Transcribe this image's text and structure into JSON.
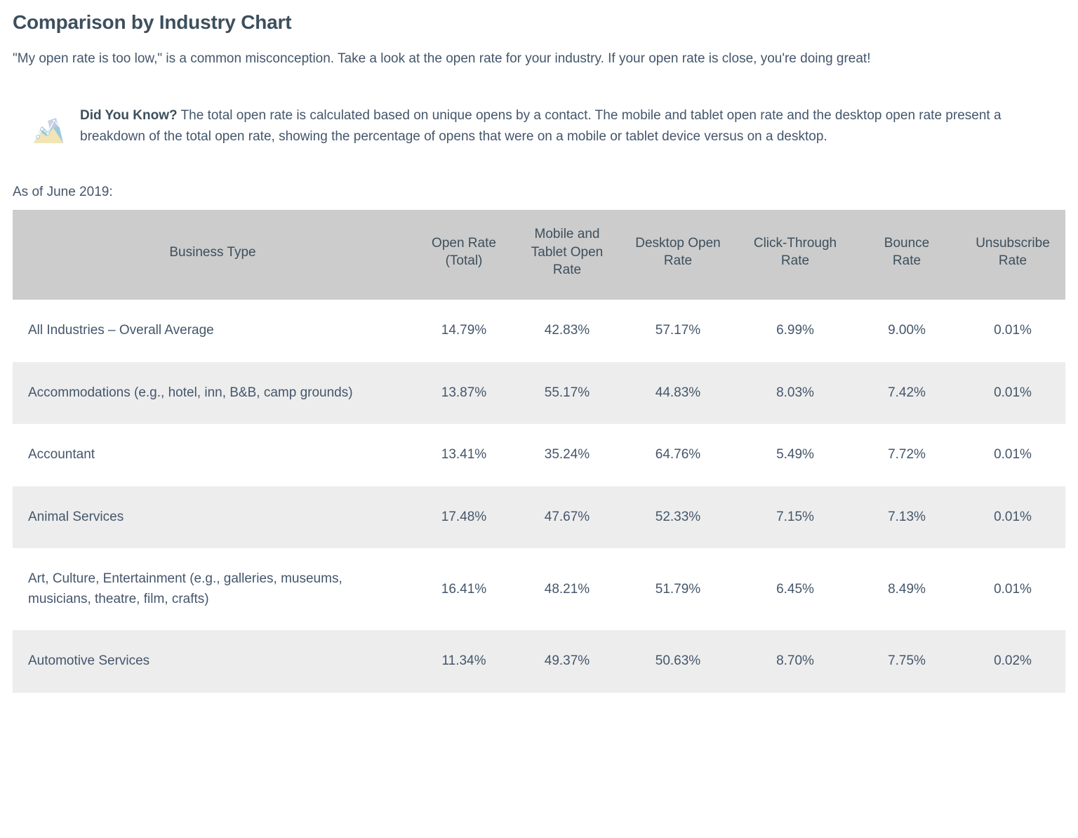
{
  "page": {
    "title": "Comparison by Industry Chart",
    "intro": "\"My open rate is too low,\" is a common misconception. Take a look at the open rate for your industry. If your open rate is close, you're doing great!",
    "as_of": "As of June 2019:"
  },
  "callout": {
    "icon": "area-chart-icon",
    "lead": "Did You Know?",
    "body": " The total open rate is calculated based on unique opens by a contact. The mobile and tablet open rate and the desktop open rate present a breakdown of the total open rate, showing the percentage of opens that were on a mobile or tablet device versus on a desktop."
  },
  "colors": {
    "title": "#3c4f5d",
    "text": "#44566b",
    "header_bg": "#cccccc",
    "zebra_bg": "#ededed",
    "row_bg": "#ffffff",
    "icon_blue": "#9ac9dd",
    "icon_yellow": "#f2e4b4",
    "icon_purple": "#c5c9e2"
  },
  "chart_data": {
    "type": "table",
    "title": "Comparison by Industry Chart",
    "subtitle": "As of June 2019:",
    "columns": [
      "Business Type",
      "Open Rate (Total)",
      "Mobile and Tablet Open Rate",
      "Desktop Open Rate",
      "Click-Through Rate",
      "Bounce Rate",
      "Unsubscribe Rate"
    ],
    "rows": [
      {
        "business_type": "All Industries – Overall Average",
        "open_rate_total": "14.79%",
        "mobile_tablet_open_rate": "42.83%",
        "desktop_open_rate": "57.17%",
        "click_through_rate": "6.99%",
        "bounce_rate": "9.00%",
        "unsubscribe_rate": "0.01%"
      },
      {
        "business_type": "Accommodations (e.g., hotel, inn, B&B, camp grounds)",
        "open_rate_total": "13.87%",
        "mobile_tablet_open_rate": "55.17%",
        "desktop_open_rate": "44.83%",
        "click_through_rate": "8.03%",
        "bounce_rate": "7.42%",
        "unsubscribe_rate": "0.01%"
      },
      {
        "business_type": "Accountant",
        "open_rate_total": "13.41%",
        "mobile_tablet_open_rate": "35.24%",
        "desktop_open_rate": "64.76%",
        "click_through_rate": "5.49%",
        "bounce_rate": "7.72%",
        "unsubscribe_rate": "0.01%"
      },
      {
        "business_type": "Animal Services",
        "open_rate_total": "17.48%",
        "mobile_tablet_open_rate": "47.67%",
        "desktop_open_rate": "52.33%",
        "click_through_rate": "7.15%",
        "bounce_rate": "7.13%",
        "unsubscribe_rate": "0.01%"
      },
      {
        "business_type": "Art, Culture, Entertainment (e.g., galleries, museums, musicians, theatre, film, crafts)",
        "open_rate_total": "16.41%",
        "mobile_tablet_open_rate": "48.21%",
        "desktop_open_rate": "51.79%",
        "click_through_rate": "6.45%",
        "bounce_rate": "8.49%",
        "unsubscribe_rate": "0.01%"
      },
      {
        "business_type": "Automotive Services",
        "open_rate_total": "11.34%",
        "mobile_tablet_open_rate": "49.37%",
        "desktop_open_rate": "50.63%",
        "click_through_rate": "8.70%",
        "bounce_rate": "7.75%",
        "unsubscribe_rate": "0.02%"
      }
    ]
  },
  "table": {
    "headers": [
      {
        "label": "Business Type"
      },
      {
        "line1": "Open Rate",
        "line2": "(Total)"
      },
      {
        "line1": "Mobile and",
        "line2": "Tablet Open",
        "line3": "Rate"
      },
      {
        "line1": "Desktop Open",
        "line2": "Rate"
      },
      {
        "line1": "Click-Through",
        "line2": "Rate"
      },
      {
        "line1": "Bounce",
        "line2": "Rate"
      },
      {
        "line1": "Unsubscribe",
        "line2": "Rate"
      }
    ]
  }
}
